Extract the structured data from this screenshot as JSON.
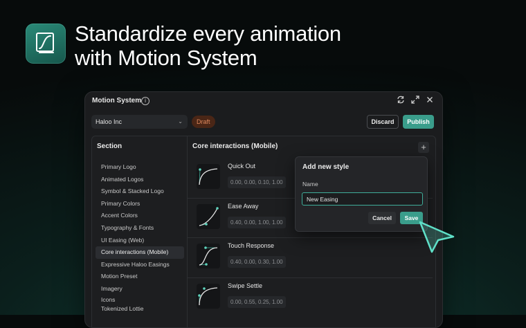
{
  "hero": {
    "title_line1": "Standardize every animation",
    "title_line2": "with Motion System",
    "icon": "easing-curve-icon"
  },
  "window": {
    "title": "Motion System",
    "controls": [
      "refresh-icon",
      "expand-icon",
      "close-icon"
    ],
    "org_select": "Haloo Inc",
    "status_badge": "Draft",
    "discard_label": "Discard",
    "publish_label": "Publish"
  },
  "sidebar": {
    "heading": "Section",
    "items": [
      {
        "label": "Primary Logo"
      },
      {
        "label": "Animated Logos"
      },
      {
        "label": "Symbol & Stacked Logo"
      },
      {
        "label": "Primary Colors"
      },
      {
        "label": "Accent Colors"
      },
      {
        "label": "Typography & Fonts"
      },
      {
        "label": "UI Easing (Web)"
      },
      {
        "label": "Core interactions (Mobile)",
        "active": true
      },
      {
        "label": "Expressive Haloo Easings"
      },
      {
        "label": "Motion Preset"
      },
      {
        "label": "Imagery"
      },
      {
        "label": "Icons"
      },
      {
        "label": "Tokenized Lottie"
      }
    ]
  },
  "main": {
    "heading": "Core interactions (Mobile)",
    "cards": [
      {
        "name": "Quick Out",
        "values": "0.00, 0.00, 0.10, 1.00"
      },
      {
        "name": "Ease Away",
        "values": "0.40, 0.00, 1.00, 1.00"
      },
      {
        "name": "Touch Response",
        "values": "0.40, 0.00, 0.30, 1.00"
      },
      {
        "name": "Swipe Settle",
        "values": "0.00, 0.55, 0.25, 1.00"
      }
    ]
  },
  "popup": {
    "title": "Add new style",
    "name_label": "Name",
    "name_value": "New Easing",
    "cancel_label": "Cancel",
    "save_label": "Save"
  },
  "colors": {
    "accent": "#3a9d8b",
    "draft_badge_bg": "#4a2616",
    "draft_badge_text": "#e08a5e",
    "cursor": "#5fe0c8"
  }
}
